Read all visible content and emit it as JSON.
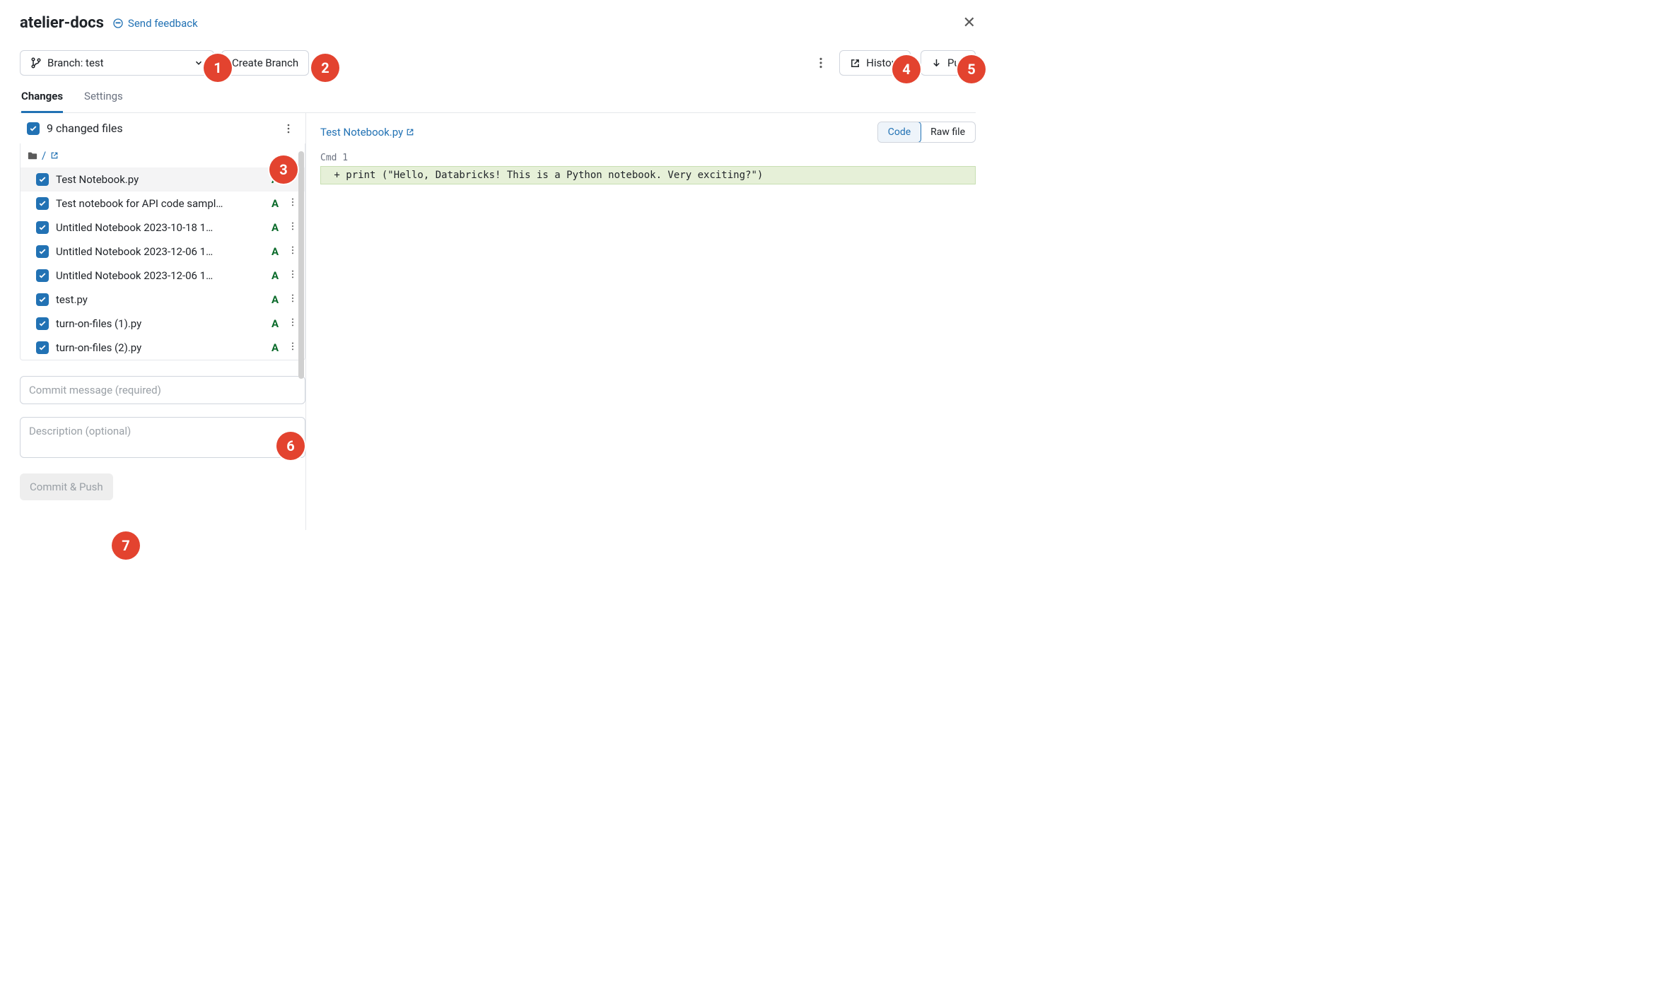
{
  "header": {
    "title": "atelier-docs",
    "feedback": "Send feedback"
  },
  "toolbar": {
    "branch_label": "Branch: test",
    "create_branch": "Create Branch",
    "history": "History",
    "pull": "Pull"
  },
  "tabs": {
    "changes": "Changes",
    "settings": "Settings"
  },
  "changes": {
    "summary": "9 changed files",
    "root": "/",
    "files": [
      {
        "name": "Test Notebook.py",
        "status": "A",
        "selected": true
      },
      {
        "name": "Test notebook for API code sampl…",
        "status": "A",
        "selected": false
      },
      {
        "name": "Untitled Notebook 2023-10-18 1…",
        "status": "A",
        "selected": false
      },
      {
        "name": "Untitled Notebook 2023-12-06 1…",
        "status": "A",
        "selected": false
      },
      {
        "name": "Untitled Notebook 2023-12-06 1…",
        "status": "A",
        "selected": false
      },
      {
        "name": "test.py",
        "status": "A",
        "selected": false
      },
      {
        "name": "turn-on-files (1).py",
        "status": "A",
        "selected": false
      },
      {
        "name": "turn-on-files (2).py",
        "status": "A",
        "selected": false
      }
    ]
  },
  "commit": {
    "message_placeholder": "Commit message (required)",
    "description_placeholder": "Description (optional)",
    "button": "Commit & Push"
  },
  "diff": {
    "filename": "Test Notebook.py",
    "view_code": "Code",
    "view_raw": "Raw file",
    "cmd_label": "Cmd 1",
    "added_line": " + print (\"Hello, Databricks! This is a Python notebook. Very exciting?\")"
  },
  "annotations": [
    "1",
    "2",
    "3",
    "4",
    "5",
    "6",
    "7"
  ]
}
